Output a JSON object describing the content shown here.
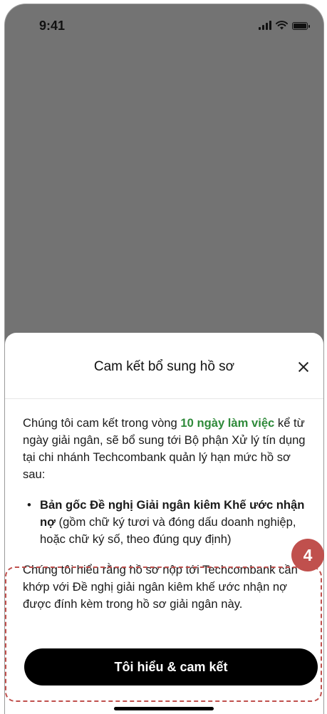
{
  "status_bar": {
    "time": "9:41"
  },
  "sheet": {
    "title": "Cam kết bổ sung hồ sơ",
    "intro": {
      "prefix": "Chúng tôi cam kết trong vòng ",
      "highlight": "10 ngày làm việc",
      "suffix": " kể từ ngày giải ngân, sẽ bổ sung tới Bộ phận Xử lý tín dụng tại chi nhánh Techcombank quản lý hạn mức hồ sơ sau:"
    },
    "bullet": {
      "marker": "•",
      "bold_text": "Bản gốc Đề nghị Giải ngân kiêm Khế ước nhận nợ",
      "rest_text": " (gồm chữ ký tươi và đóng dấu doanh nghiệp, hoặc chữ ký số, theo đúng quy định)"
    },
    "note": "Chúng tôi hiểu rằng hồ sơ nộp tới Techcombank cần khớp với Đề nghị giải ngân kiêm khế ước nhận nợ được đính kèm trong hồ sơ giải ngân này.",
    "confirm_button": "Tôi hiểu & cam kết"
  },
  "annotation": {
    "step_number": "4",
    "color": "#c0504d"
  },
  "colors": {
    "accent_green": "#2f8a3a",
    "button_bg": "#000000",
    "overlay": "#737373"
  }
}
